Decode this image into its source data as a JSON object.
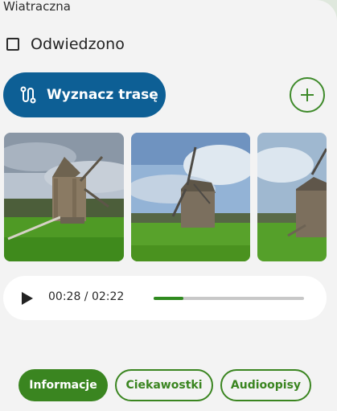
{
  "place_name": "Wiatraczna",
  "visited": {
    "label": "Odwiedzono",
    "checked": false
  },
  "route_button": {
    "label": "Wyznacz trasę",
    "icon": "route-icon"
  },
  "add_button": {
    "icon": "plus-icon"
  },
  "gallery": {
    "photos": [
      {
        "alt": "windmill-photo-1"
      },
      {
        "alt": "windmill-photo-2"
      },
      {
        "alt": "windmill-photo-3"
      }
    ]
  },
  "audio_player": {
    "current": "00:28",
    "total": "02:22",
    "time_display": "00:28 / 02:22",
    "progress": 0.2,
    "play_icon": "play-icon"
  },
  "tabs": [
    {
      "label": "Informacje",
      "active": true
    },
    {
      "label": "Ciekawostki",
      "active": false
    },
    {
      "label": "Audioopisy",
      "active": false
    }
  ],
  "colors": {
    "primary_blue": "#0d5f95",
    "accent_green": "#3a8520",
    "progress_green": "#2f8a1f",
    "background": "#f3f3f3"
  }
}
